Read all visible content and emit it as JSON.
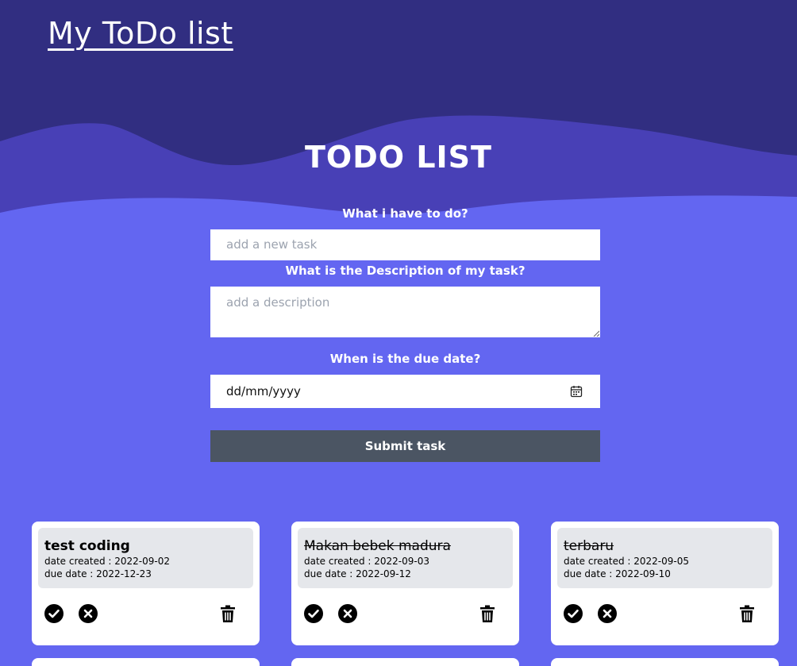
{
  "header": {
    "brand": "My ToDo list"
  },
  "main": {
    "heading": "TODO LIST",
    "form": {
      "task_label": "What i have to do?",
      "task_placeholder": "add a new task",
      "description_label": "What is the Description of my task?",
      "description_placeholder": "add a description",
      "due_label": "When is the due date?",
      "due_value": "dd/mm/yyyy",
      "submit_label": "Submit task"
    }
  },
  "tasks": [
    {
      "title": "test coding",
      "completed": false,
      "created": "date created : 2022-09-02",
      "due": "due date : 2022-12-23"
    },
    {
      "title": "Makan bebek madura",
      "completed": true,
      "created": "date created : 2022-09-03",
      "due": "due date : 2022-09-12"
    },
    {
      "title": "terbaru",
      "completed": true,
      "created": "date created : 2022-09-05",
      "due": "due date : 2022-09-10"
    }
  ],
  "icons": {
    "complete": "check-circle-icon",
    "remove": "x-circle-icon",
    "delete": "trash-icon",
    "calendar": "calendar-icon"
  },
  "colors": {
    "background": "#6366f1",
    "wave_dark": "#312e81",
    "wave_mid": "#4840b6",
    "button": "#4b5563",
    "card_inner": "#e5e7eb"
  }
}
